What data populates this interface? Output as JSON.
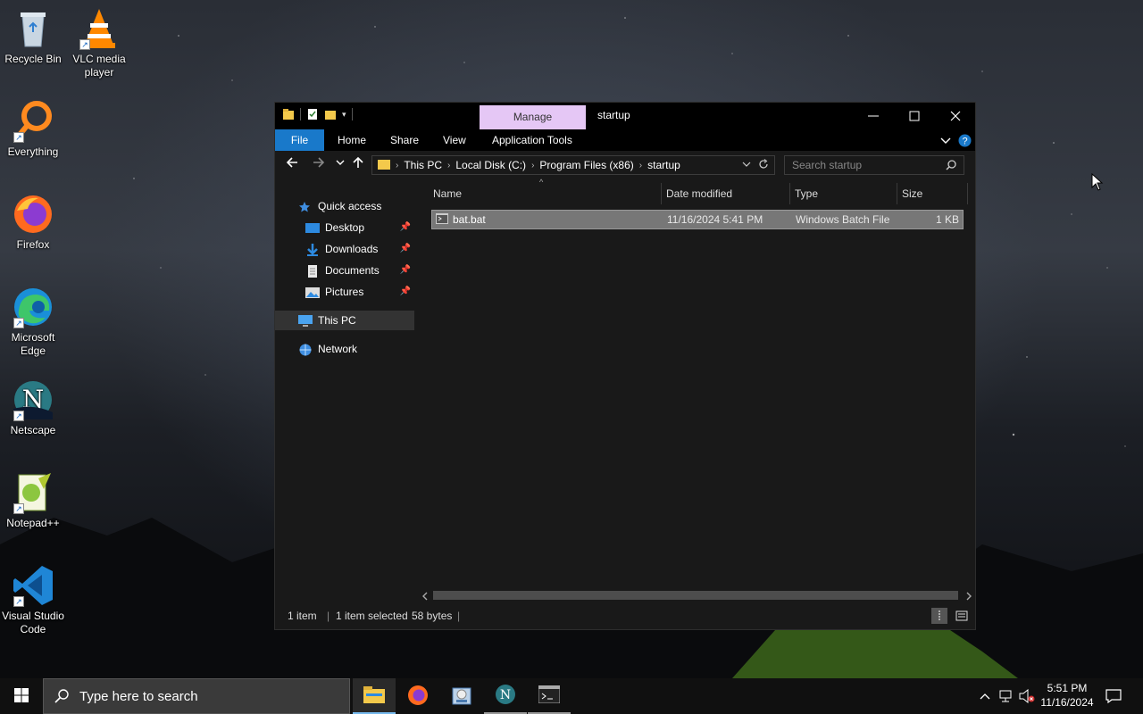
{
  "desktop": {
    "icons": [
      {
        "label": "Recycle Bin",
        "icon": "recycle-bin-icon"
      },
      {
        "label": "VLC media player",
        "icon": "vlc-icon"
      },
      {
        "label": "Everything",
        "icon": "everything-icon"
      },
      {
        "label": "Firefox",
        "icon": "firefox-icon"
      },
      {
        "label": "Microsoft Edge",
        "icon": "edge-icon"
      },
      {
        "label": "Netscape",
        "icon": "netscape-icon"
      },
      {
        "label": "Notepad++",
        "icon": "notepadpp-icon"
      },
      {
        "label": "Visual Studio Code",
        "icon": "vscode-icon"
      }
    ]
  },
  "window": {
    "title": "startup",
    "contextual_tab": "Manage",
    "ribbon_tabs": {
      "file": "File",
      "home": "Home",
      "share": "Share",
      "view": "View",
      "app_tools": "Application Tools"
    },
    "breadcrumb": [
      "This PC",
      "Local Disk (C:)",
      "Program Files (x86)",
      "startup"
    ],
    "search_placeholder": "Search startup",
    "nav": {
      "quick_access": "Quick access",
      "desktop": "Desktop",
      "downloads": "Downloads",
      "documents": "Documents",
      "pictures": "Pictures",
      "this_pc": "This PC",
      "network": "Network"
    },
    "columns": {
      "name": "Name",
      "date": "Date modified",
      "type": "Type",
      "size": "Size"
    },
    "files": [
      {
        "name": "bat.bat",
        "date": "11/16/2024 5:41 PM",
        "type": "Windows Batch File",
        "size": "1 KB"
      }
    ],
    "status": {
      "count": "1 item",
      "selected": "1 item selected",
      "bytes": "58 bytes"
    }
  },
  "taskbar": {
    "search_placeholder": "Type here to search",
    "time": "5:51 PM",
    "date": "11/16/2024"
  },
  "colors": {
    "accent": "#1979ca",
    "manage_tab": "#e5c7f5",
    "selected_row": "#777777"
  }
}
